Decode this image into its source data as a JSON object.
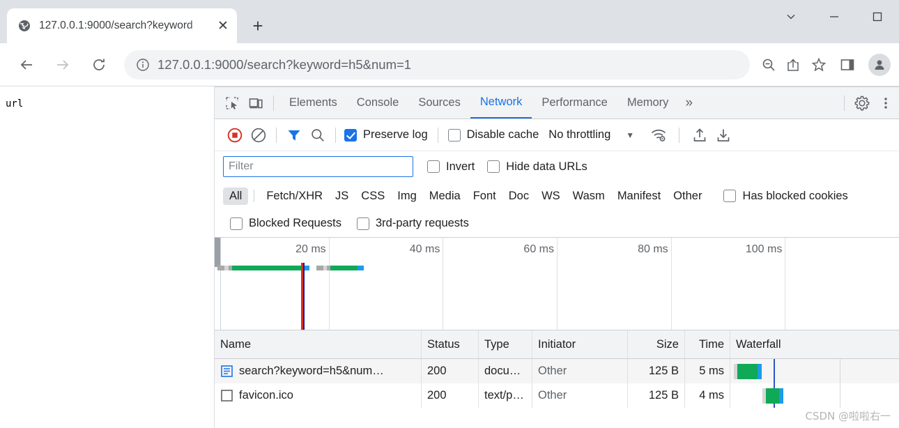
{
  "browser": {
    "tab": {
      "favicon": "globe-icon",
      "title": "127.0.0.1:9000/search?keyword",
      "close_label": "✕"
    },
    "new_tab_label": "+",
    "window_controls": [
      {
        "name": "tab-search",
        "glyph": "∨"
      },
      {
        "name": "minimize",
        "glyph": "—"
      },
      {
        "name": "maximize",
        "glyph": "☐"
      }
    ],
    "toolbar": {
      "back": "back-arrow",
      "forward": "forward-arrow",
      "reload": "reload-icon",
      "info": "info-icon",
      "url": "127.0.0.1:9000/search?keyword=h5&num=1",
      "zoom_out": "zoom-out-icon",
      "share": "share-icon",
      "bookmark": "star-icon",
      "side_panel": "side-panel-icon",
      "profile": "avatar-icon"
    }
  },
  "page": {
    "body_text": "url"
  },
  "devtools": {
    "left_icons": [
      {
        "name": "inspect-element-icon"
      },
      {
        "name": "device-toolbar-icon"
      }
    ],
    "tabs": [
      {
        "label": "Elements",
        "active": false
      },
      {
        "label": "Console",
        "active": false
      },
      {
        "label": "Sources",
        "active": false
      },
      {
        "label": "Network",
        "active": true
      },
      {
        "label": "Performance",
        "active": false
      },
      {
        "label": "Memory",
        "active": false
      }
    ],
    "more_tabs_label": "»",
    "settings_icon": "gear-icon",
    "menu_icon": "kebab-menu-icon",
    "network_toolbar": {
      "record_icon": "record-stop-icon",
      "clear_icon": "clear-icon",
      "filter_icon": "funnel-icon",
      "search_icon": "search-icon",
      "preserve_log": {
        "label": "Preserve log",
        "checked": true
      },
      "disable_cache": {
        "label": "Disable cache",
        "checked": false
      },
      "throttling": "No throttling",
      "throttle_caret": "▼",
      "network_conditions_icon": "wifi-settings-icon",
      "import_icon": "import-har-icon",
      "export_icon": "export-har-icon"
    },
    "filter_row": {
      "filter_placeholder": "Filter",
      "filter_value": "",
      "invert": {
        "label": "Invert",
        "checked": false
      },
      "hide_data_urls": {
        "label": "Hide data URLs",
        "checked": false
      }
    },
    "type_filters": [
      {
        "label": "All",
        "active": true
      },
      {
        "label": "Fetch/XHR",
        "active": false
      },
      {
        "label": "JS",
        "active": false
      },
      {
        "label": "CSS",
        "active": false
      },
      {
        "label": "Img",
        "active": false
      },
      {
        "label": "Media",
        "active": false
      },
      {
        "label": "Font",
        "active": false
      },
      {
        "label": "Doc",
        "active": false
      },
      {
        "label": "WS",
        "active": false
      },
      {
        "label": "Wasm",
        "active": false
      },
      {
        "label": "Manifest",
        "active": false
      },
      {
        "label": "Other",
        "active": false
      }
    ],
    "has_blocked_cookies": {
      "label": "Has blocked cookies",
      "checked": false
    },
    "blocked_requests": {
      "label": "Blocked Requests",
      "checked": false
    },
    "third_party_requests": {
      "label": "3rd-party requests",
      "checked": false
    },
    "overview": {
      "ticks": [
        "20 ms",
        "40 ms",
        "60 ms",
        "80 ms",
        "100 ms"
      ],
      "bars": [
        {
          "left_pct": 0.4,
          "queue_pct": 1.0,
          "gap_pct": 0.6,
          "wait_pct": 0.5,
          "download_pct": 10.5,
          "end_pct": 0.9
        },
        {
          "left_pct": 14.9,
          "queue_pct": 1.0,
          "gap_pct": 0.5,
          "wait_pct": 0.5,
          "download_pct": 4.0,
          "end_pct": 0.9
        }
      ],
      "events": [
        {
          "name": "dom-content-loaded",
          "color": "#1a1aa6",
          "left_pct": 12.8
        },
        {
          "name": "load",
          "color": "#d93025",
          "left_pct": 12.6
        }
      ]
    },
    "requests_table": {
      "columns": [
        "Name",
        "Status",
        "Type",
        "Initiator",
        "Size",
        "Time",
        "Waterfall"
      ],
      "rows": [
        {
          "icon": "document-icon",
          "name": "search?keyword=h5&num…",
          "status": "200",
          "type": "docu…",
          "initiator": "Other",
          "size": "125 B",
          "time": "5 ms",
          "wf_left_pct": 2.0,
          "wf_queue_pct": 2.0,
          "wf_download_pct": 12.0,
          "wf_end_pct": 2.5
        },
        {
          "icon": "generic-file-icon",
          "name": "favicon.ico",
          "status": "200",
          "type": "text/p…",
          "initiator": "Other",
          "size": "125 B",
          "time": "4 ms",
          "wf_left_pct": 19.0,
          "wf_queue_pct": 2.0,
          "wf_download_pct": 8.0,
          "wf_end_pct": 2.5
        }
      ],
      "main_line_pct": 25.5,
      "divider_pct": 65.0
    }
  },
  "watermark": "CSDN @啦啦右一"
}
